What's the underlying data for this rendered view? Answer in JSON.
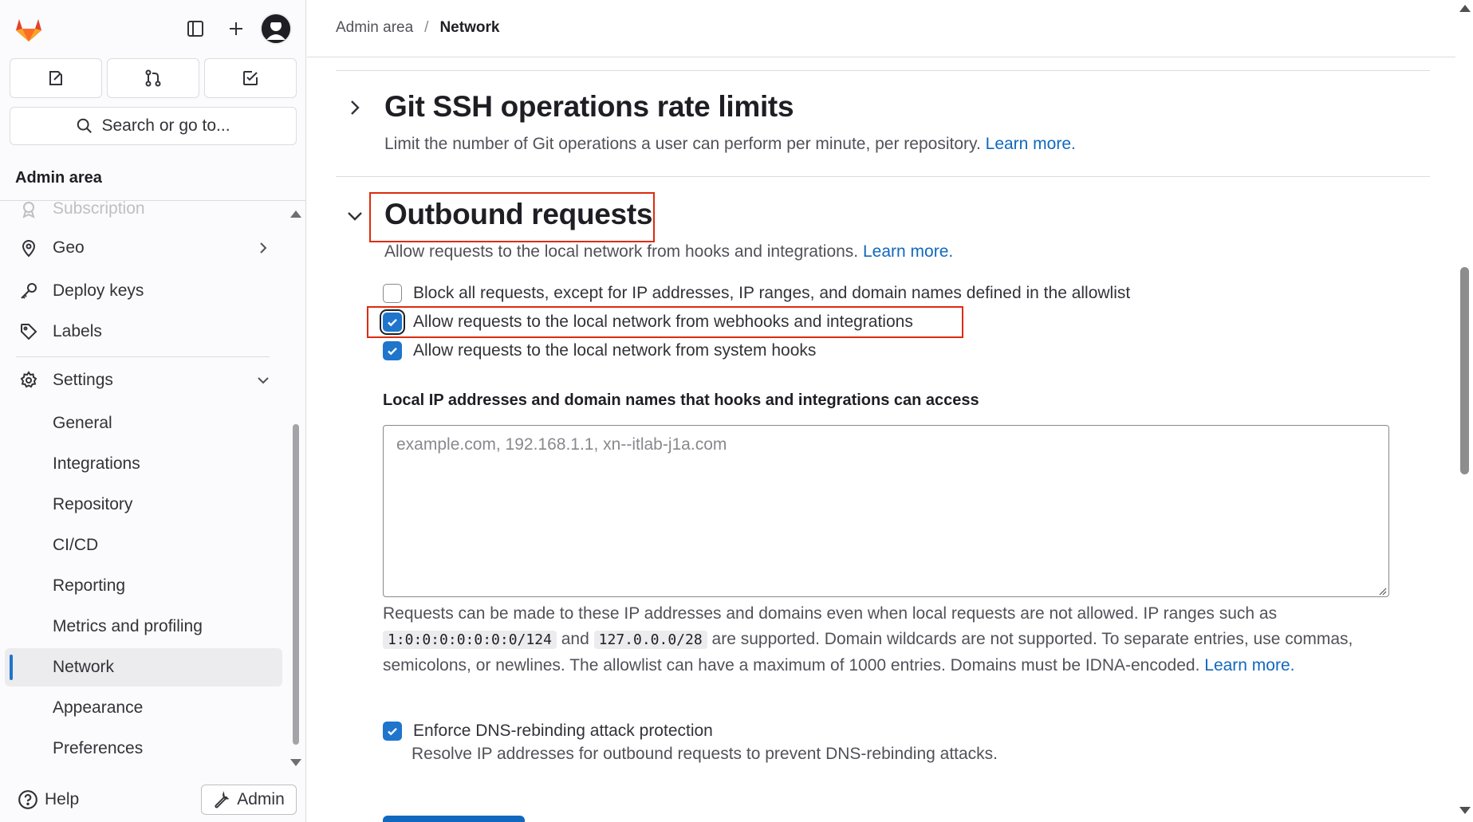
{
  "sidebar": {
    "logo_icon": "gitlab-tanuki-icon",
    "top_icons": [
      "sidebar-toggle-icon",
      "plus-icon",
      "user-avatar"
    ],
    "quick_buttons": [
      "issues-icon",
      "merge-requests-icon",
      "todo-icon"
    ],
    "search_label": "Search or go to...",
    "title": "Admin area",
    "items": [
      {
        "label": "Subscription",
        "icon": "license-icon"
      },
      {
        "label": "Geo",
        "icon": "location-pin-icon"
      },
      {
        "label": "Deploy keys",
        "icon": "key-icon"
      },
      {
        "label": "Labels",
        "icon": "label-icon"
      },
      {
        "label": "Settings",
        "icon": "gear-icon"
      }
    ],
    "settings_sub": [
      {
        "label": "General"
      },
      {
        "label": "Integrations"
      },
      {
        "label": "Repository"
      },
      {
        "label": "CI/CD"
      },
      {
        "label": "Reporting"
      },
      {
        "label": "Metrics and profiling"
      },
      {
        "label": "Network",
        "active": true
      },
      {
        "label": "Appearance"
      },
      {
        "label": "Preferences"
      }
    ],
    "help_label": "Help",
    "admin_label": "Admin"
  },
  "breadcrumb": {
    "parent": "Admin area",
    "separator": "/",
    "current": "Network"
  },
  "git_ssh": {
    "title": "Git SSH operations rate limits",
    "description": "Limit the number of Git operations a user can perform per minute, per repository.",
    "learn_more": "Learn more."
  },
  "outbound": {
    "title": "Outbound requests",
    "description": "Allow requests to the local network from hooks and integrations.",
    "learn_more": "Learn more.",
    "checkboxes": [
      {
        "label": "Block all requests, except for IP addresses, IP ranges, and domain names defined in the allowlist",
        "checked": false
      },
      {
        "label": "Allow requests to the local network from webhooks and integrations",
        "checked": true
      },
      {
        "label": "Allow requests to the local network from system hooks",
        "checked": true
      }
    ],
    "allowlist_label": "Local IP addresses and domain names that hooks and integrations can access",
    "allowlist_value": "",
    "allowlist_placeholder": "example.com, 192.168.1.1, xn--itlab-j1a.com",
    "help_part1": "Requests can be made to these IP addresses and domains even when local requests are not allowed. IP ranges such as",
    "code1": "1:0:0:0:0:0:0:0/124",
    "help_and": "and",
    "code2": "127.0.0.0/28",
    "help_part2": "are supported. Domain wildcards are not supported. To separate entries, use commas, semicolons, or newlines. The allowlist can have a maximum of 1000 entries. Domains must be IDNA-encoded.",
    "help_learn_more": "Learn more.",
    "dns": {
      "label": "Enforce DNS-rebinding attack protection",
      "checked": true,
      "description": "Resolve IP addresses for outbound requests to prevent DNS-rebinding attacks."
    }
  },
  "colors": {
    "accent": "#1f75cb",
    "link": "#1068bf",
    "highlight": "#dd2b0e",
    "brand_orange": "#e24329"
  }
}
